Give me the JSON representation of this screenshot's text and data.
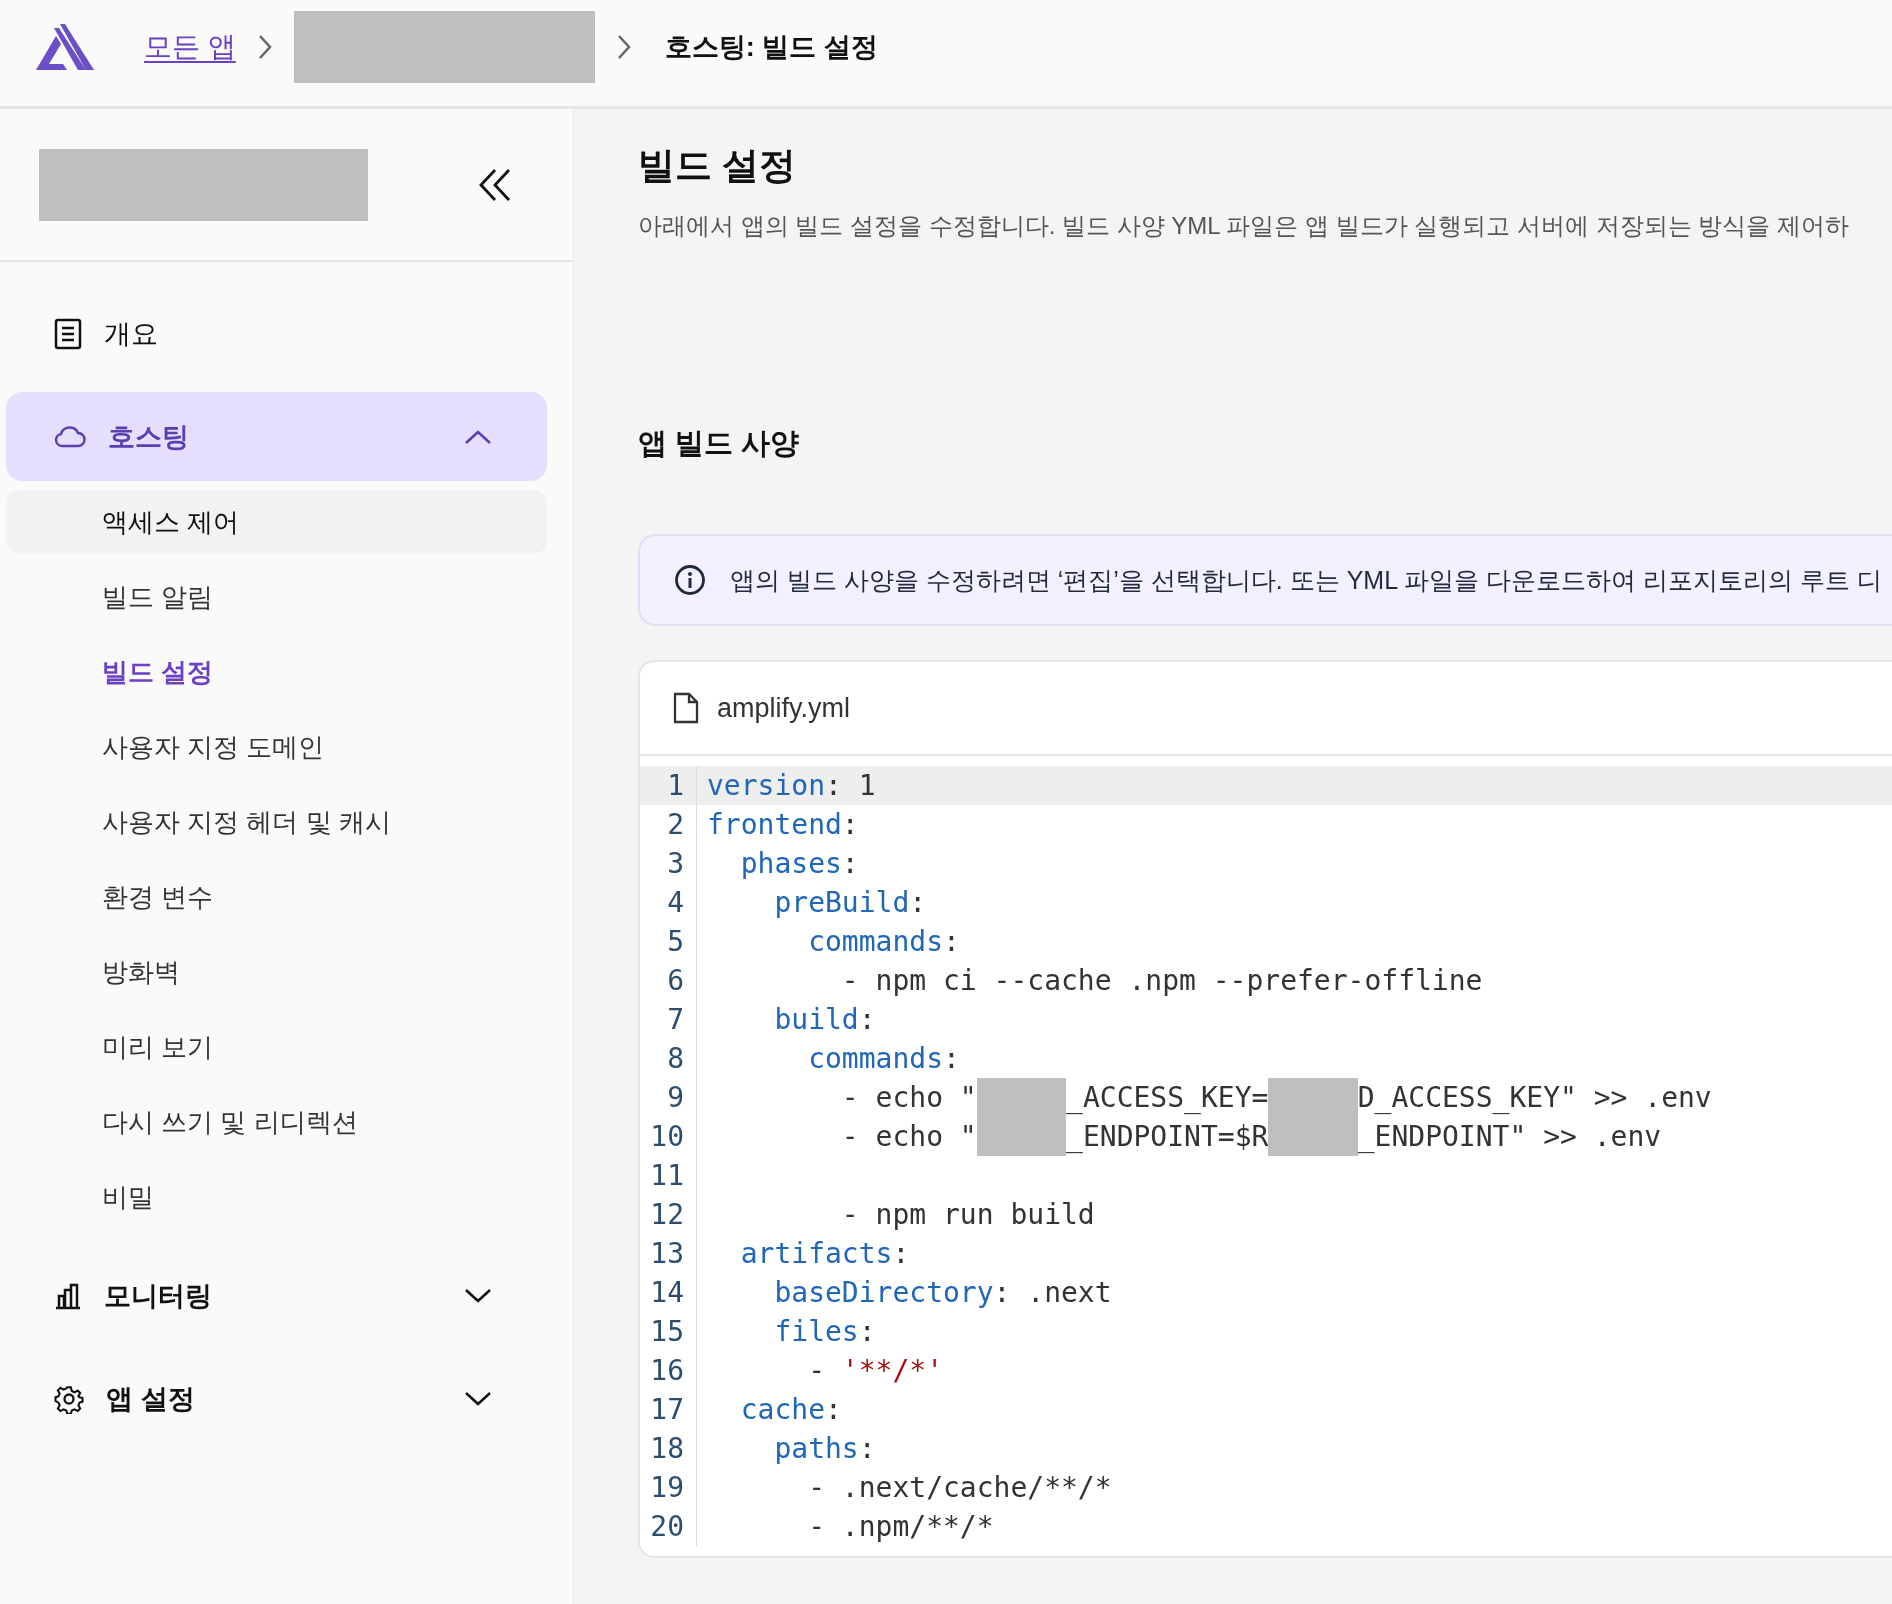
{
  "breadcrumb": {
    "home": "모든 앱",
    "current": "호스팅: 빌드 설정"
  },
  "sidebar": {
    "items": [
      {
        "label": "개요",
        "kind": "link",
        "selected": false
      },
      {
        "label": "호스팅",
        "kind": "group",
        "selected": true,
        "expanded": true,
        "children": [
          {
            "label": "액세스 제어",
            "selected": false,
            "hovered": true
          },
          {
            "label": "빌드 알림",
            "selected": false,
            "hovered": false
          },
          {
            "label": "빌드 설정",
            "selected": true,
            "hovered": false
          },
          {
            "label": "사용자 지정 도메인",
            "selected": false,
            "hovered": false
          },
          {
            "label": "사용자 지정 헤더 및 캐시",
            "selected": false,
            "hovered": false
          },
          {
            "label": "환경 변수",
            "selected": false,
            "hovered": false
          },
          {
            "label": "방화벽",
            "selected": false,
            "hovered": false
          },
          {
            "label": "미리 보기",
            "selected": false,
            "hovered": false
          },
          {
            "label": "다시 쓰기 및 리디렉션",
            "selected": false,
            "hovered": false
          },
          {
            "label": "비밀",
            "selected": false,
            "hovered": false
          }
        ]
      },
      {
        "label": "모니터링",
        "kind": "group",
        "selected": false,
        "expanded": false
      },
      {
        "label": "앱 설정",
        "kind": "group",
        "selected": false,
        "expanded": false
      }
    ]
  },
  "page": {
    "title": "빌드 설정",
    "description": "아래에서 앱의 빌드 설정을 수정합니다. 빌드 사양 YML 파일은 앱 빌드가 실행되고 서버에 저장되는 방식을 제어하",
    "section_title": "앱 빌드 사양",
    "info": "앱의 빌드 사양을 수정하려면 ‘편집’을 선택합니다. 또는 YML 파일을 다운로드하여 리포지토리의 루트 디"
  },
  "file": {
    "name": "amplify.yml",
    "lines": [
      {
        "number": "1",
        "active": true,
        "segments": [
          {
            "kind": "key",
            "text": "version"
          },
          {
            "kind": "plain",
            "text": ": 1"
          }
        ]
      },
      {
        "number": "2",
        "active": false,
        "segments": [
          {
            "kind": "key",
            "text": "frontend"
          },
          {
            "kind": "plain",
            "text": ":"
          }
        ]
      },
      {
        "number": "3",
        "active": false,
        "segments": [
          {
            "kind": "key",
            "text": "  phases"
          },
          {
            "kind": "plain",
            "text": ":"
          }
        ]
      },
      {
        "number": "4",
        "active": false,
        "segments": [
          {
            "kind": "key",
            "text": "    preBuild"
          },
          {
            "kind": "plain",
            "text": ":"
          }
        ]
      },
      {
        "number": "5",
        "active": false,
        "segments": [
          {
            "kind": "key",
            "text": "      commands"
          },
          {
            "kind": "plain",
            "text": ":"
          }
        ]
      },
      {
        "number": "6",
        "active": false,
        "segments": [
          {
            "kind": "plain",
            "text": "        - npm ci --cache .npm --prefer-offline"
          }
        ]
      },
      {
        "number": "7",
        "active": false,
        "segments": [
          {
            "kind": "key",
            "text": "    build"
          },
          {
            "kind": "plain",
            "text": ":"
          }
        ]
      },
      {
        "number": "8",
        "active": false,
        "segments": [
          {
            "kind": "key",
            "text": "      commands"
          },
          {
            "kind": "plain",
            "text": ":"
          }
        ]
      },
      {
        "number": "9",
        "active": false,
        "segments": [
          {
            "kind": "plain",
            "text": "        - echo \""
          },
          {
            "kind": "redacted"
          },
          {
            "kind": "plain",
            "text": "_ACCESS_KEY="
          },
          {
            "kind": "redacted"
          },
          {
            "kind": "plain",
            "text": "D_ACCESS_KEY\" >> .env"
          }
        ]
      },
      {
        "number": "10",
        "active": false,
        "segments": [
          {
            "kind": "plain",
            "text": "        - echo \""
          },
          {
            "kind": "redacted"
          },
          {
            "kind": "plain",
            "text": "_ENDPOINT=$R"
          },
          {
            "kind": "redacted"
          },
          {
            "kind": "plain",
            "text": "_ENDPOINT\" >> .env"
          }
        ]
      },
      {
        "number": "11",
        "active": false
      },
      {
        "number": "12",
        "active": false,
        "segments": [
          {
            "kind": "plain",
            "text": "        - npm run build"
          }
        ]
      },
      {
        "number": "13",
        "active": false,
        "segments": [
          {
            "kind": "key",
            "text": "  artifacts"
          },
          {
            "kind": "plain",
            "text": ":"
          }
        ]
      },
      {
        "number": "14",
        "active": false,
        "segments": [
          {
            "kind": "key",
            "text": "    baseDirectory"
          },
          {
            "kind": "plain",
            "text": ": .next"
          }
        ]
      },
      {
        "number": "15",
        "active": false,
        "segments": [
          {
            "kind": "key",
            "text": "    files"
          },
          {
            "kind": "plain",
            "text": ":"
          }
        ]
      },
      {
        "number": "16",
        "active": false,
        "segments": [
          {
            "kind": "plain",
            "text": "      - "
          },
          {
            "kind": "string",
            "text": "'**/*'"
          }
        ]
      },
      {
        "number": "17",
        "active": false,
        "segments": [
          {
            "kind": "key",
            "text": "  cache"
          },
          {
            "kind": "plain",
            "text": ":"
          }
        ]
      },
      {
        "number": "18",
        "active": false,
        "segments": [
          {
            "kind": "key",
            "text": "    paths"
          },
          {
            "kind": "plain",
            "text": ":"
          }
        ]
      },
      {
        "number": "19",
        "active": false,
        "segments": [
          {
            "kind": "plain",
            "text": "      - .next/cache/**/*"
          }
        ]
      },
      {
        "number": "20",
        "active": false,
        "segments": [
          {
            "kind": "plain",
            "text": "      - .npm/**/*"
          }
        ]
      }
    ]
  }
}
